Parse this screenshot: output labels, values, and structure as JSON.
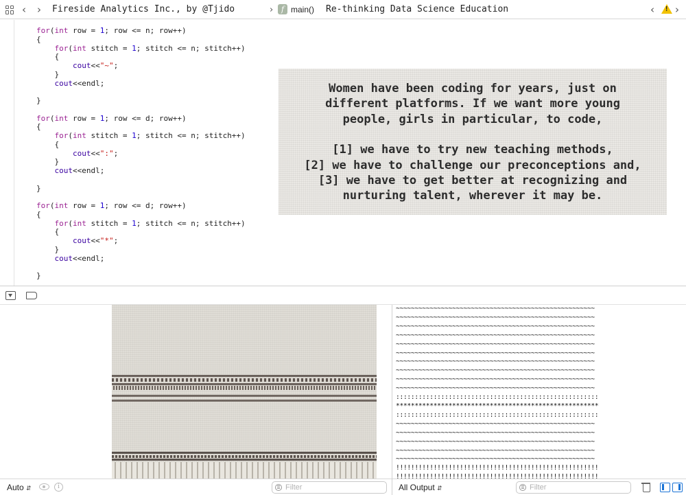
{
  "jumpbar": {
    "project_title": "Fireside Analytics Inc., by @Tjido",
    "function_label": "main()",
    "file_title": "Re-thinking Data Science Education",
    "function_badge": "f",
    "warning_badge": "!"
  },
  "editor": {
    "code_lines": [
      [
        {
          "t": "for",
          "c": "kw"
        },
        {
          "t": "(",
          "c": ""
        },
        {
          "t": "int",
          "c": "kw"
        },
        {
          "t": " row = ",
          "c": ""
        },
        {
          "t": "1",
          "c": "num"
        },
        {
          "t": "; row <= n; row++)",
          "c": ""
        }
      ],
      [
        {
          "t": "{",
          "c": ""
        }
      ],
      [
        {
          "t": "    ",
          "c": ""
        },
        {
          "t": "for",
          "c": "kw"
        },
        {
          "t": "(",
          "c": ""
        },
        {
          "t": "int",
          "c": "kw"
        },
        {
          "t": " stitch = ",
          "c": ""
        },
        {
          "t": "1",
          "c": "num"
        },
        {
          "t": "; stitch <= n; stitch++)",
          "c": ""
        }
      ],
      [
        {
          "t": "    {",
          "c": ""
        }
      ],
      [
        {
          "t": "        ",
          "c": ""
        },
        {
          "t": "cout",
          "c": "fn"
        },
        {
          "t": "<<",
          "c": ""
        },
        {
          "t": "\"~\"",
          "c": "str"
        },
        {
          "t": ";",
          "c": ""
        }
      ],
      [
        {
          "t": "    }",
          "c": ""
        }
      ],
      [
        {
          "t": "    ",
          "c": ""
        },
        {
          "t": "cout",
          "c": "fn"
        },
        {
          "t": "<<endl;",
          "c": ""
        }
      ],
      [
        {
          "t": "",
          "c": ""
        }
      ],
      [
        {
          "t": "}",
          "c": ""
        }
      ],
      [
        {
          "t": "",
          "c": ""
        }
      ],
      [
        {
          "t": "for",
          "c": "kw"
        },
        {
          "t": "(",
          "c": ""
        },
        {
          "t": "int",
          "c": "kw"
        },
        {
          "t": " row = ",
          "c": ""
        },
        {
          "t": "1",
          "c": "num"
        },
        {
          "t": "; row <= d; row++)",
          "c": ""
        }
      ],
      [
        {
          "t": "{",
          "c": ""
        }
      ],
      [
        {
          "t": "    ",
          "c": ""
        },
        {
          "t": "for",
          "c": "kw"
        },
        {
          "t": "(",
          "c": ""
        },
        {
          "t": "int",
          "c": "kw"
        },
        {
          "t": " stitch = ",
          "c": ""
        },
        {
          "t": "1",
          "c": "num"
        },
        {
          "t": "; stitch <= n; stitch++)",
          "c": ""
        }
      ],
      [
        {
          "t": "    {",
          "c": ""
        }
      ],
      [
        {
          "t": "        ",
          "c": ""
        },
        {
          "t": "cout",
          "c": "fn"
        },
        {
          "t": "<<",
          "c": ""
        },
        {
          "t": "\":\"",
          "c": "str"
        },
        {
          "t": ";",
          "c": ""
        }
      ],
      [
        {
          "t": "    }",
          "c": ""
        }
      ],
      [
        {
          "t": "    ",
          "c": ""
        },
        {
          "t": "cout",
          "c": "fn"
        },
        {
          "t": "<<endl;",
          "c": ""
        }
      ],
      [
        {
          "t": "",
          "c": ""
        }
      ],
      [
        {
          "t": "}",
          "c": ""
        }
      ],
      [
        {
          "t": "",
          "c": ""
        }
      ],
      [
        {
          "t": "for",
          "c": "kw"
        },
        {
          "t": "(",
          "c": ""
        },
        {
          "t": "int",
          "c": "kw"
        },
        {
          "t": " row = ",
          "c": ""
        },
        {
          "t": "1",
          "c": "num"
        },
        {
          "t": "; row <= d; row++)",
          "c": ""
        }
      ],
      [
        {
          "t": "{",
          "c": ""
        }
      ],
      [
        {
          "t": "    ",
          "c": ""
        },
        {
          "t": "for",
          "c": "kw"
        },
        {
          "t": "(",
          "c": ""
        },
        {
          "t": "int",
          "c": "kw"
        },
        {
          "t": " stitch = ",
          "c": ""
        },
        {
          "t": "1",
          "c": "num"
        },
        {
          "t": "; stitch <= n; stitch++)",
          "c": ""
        }
      ],
      [
        {
          "t": "    {",
          "c": ""
        }
      ],
      [
        {
          "t": "        ",
          "c": ""
        },
        {
          "t": "cout",
          "c": "fn"
        },
        {
          "t": "<<",
          "c": ""
        },
        {
          "t": "\"*\"",
          "c": "str"
        },
        {
          "t": ";",
          "c": ""
        }
      ],
      [
        {
          "t": "    }",
          "c": ""
        }
      ],
      [
        {
          "t": "    ",
          "c": ""
        },
        {
          "t": "cout",
          "c": "fn"
        },
        {
          "t": "<<endl;",
          "c": ""
        }
      ],
      [
        {
          "t": "",
          "c": ""
        }
      ],
      [
        {
          "t": "}",
          "c": ""
        }
      ]
    ],
    "quote": {
      "para1": [
        "Women have been coding for years, just on",
        "different platforms. If we want more young",
        "people, girls in particular, to code,"
      ],
      "para2": [
        "[1] we have to try new teaching methods,",
        "[2] we have to challenge our preconceptions and,",
        "[3] we have to get better at recognizing and",
        "nurturing talent, wherever it may be."
      ]
    }
  },
  "console": {
    "output_lines": [
      "~~~~~~~~~~~~~~~~~~~~~~~~~~~~~~~~~~~~~~~~~~~~~~~~~~~~~",
      "~~~~~~~~~~~~~~~~~~~~~~~~~~~~~~~~~~~~~~~~~~~~~~~~~~~~~",
      "~~~~~~~~~~~~~~~~~~~~~~~~~~~~~~~~~~~~~~~~~~~~~~~~~~~~~",
      "~~~~~~~~~~~~~~~~~~~~~~~~~~~~~~~~~~~~~~~~~~~~~~~~~~~~~",
      "~~~~~~~~~~~~~~~~~~~~~~~~~~~~~~~~~~~~~~~~~~~~~~~~~~~~~",
      "~~~~~~~~~~~~~~~~~~~~~~~~~~~~~~~~~~~~~~~~~~~~~~~~~~~~~",
      "~~~~~~~~~~~~~~~~~~~~~~~~~~~~~~~~~~~~~~~~~~~~~~~~~~~~~",
      "~~~~~~~~~~~~~~~~~~~~~~~~~~~~~~~~~~~~~~~~~~~~~~~~~~~~~",
      "~~~~~~~~~~~~~~~~~~~~~~~~~~~~~~~~~~~~~~~~~~~~~~~~~~~~~",
      "~~~~~~~~~~~~~~~~~~~~~~~~~~~~~~~~~~~~~~~~~~~~~~~~~~~~~",
      "::::::::::::::::::::::::::::::::::::::::::::::::::::::",
      "******************************************************",
      "::::::::::::::::::::::::::::::::::::::::::::::::::::::",
      "~~~~~~~~~~~~~~~~~~~~~~~~~~~~~~~~~~~~~~~~~~~~~~~~~~~~~",
      "~~~~~~~~~~~~~~~~~~~~~~~~~~~~~~~~~~~~~~~~~~~~~~~~~~~~~",
      "~~~~~~~~~~~~~~~~~~~~~~~~~~~~~~~~~~~~~~~~~~~~~~~~~~~~~",
      "~~~~~~~~~~~~~~~~~~~~~~~~~~~~~~~~~~~~~~~~~~~~~~~~~~~~~",
      "~~~~~~~~~~~~~~~~~~~~~~~~~~~~~~~~~~~~~~~~~~~~~~~~~~~~~",
      "!!!!!!!!!!!!!!!!!!!!!!!!!!!!!!!!!!!!!!!!!!!!!!!!!!!!!!",
      "!!!!!!!!!!!!!!!!!!!!!!!!!!!!!!!!!!!!!!!!!!!!!!!!!!!!!!"
    ]
  },
  "statusbar": {
    "auto_label": "Auto",
    "output_selector": "All Output",
    "filter_placeholder_left": "Filter",
    "filter_placeholder_right": "Filter",
    "info_glyph": "i"
  },
  "colors": {
    "keyword": "#9b2393",
    "number": "#1c00cf",
    "string": "#c41a16",
    "accent_blue": "#1a73d6",
    "warning_yellow": "#f2c200"
  }
}
